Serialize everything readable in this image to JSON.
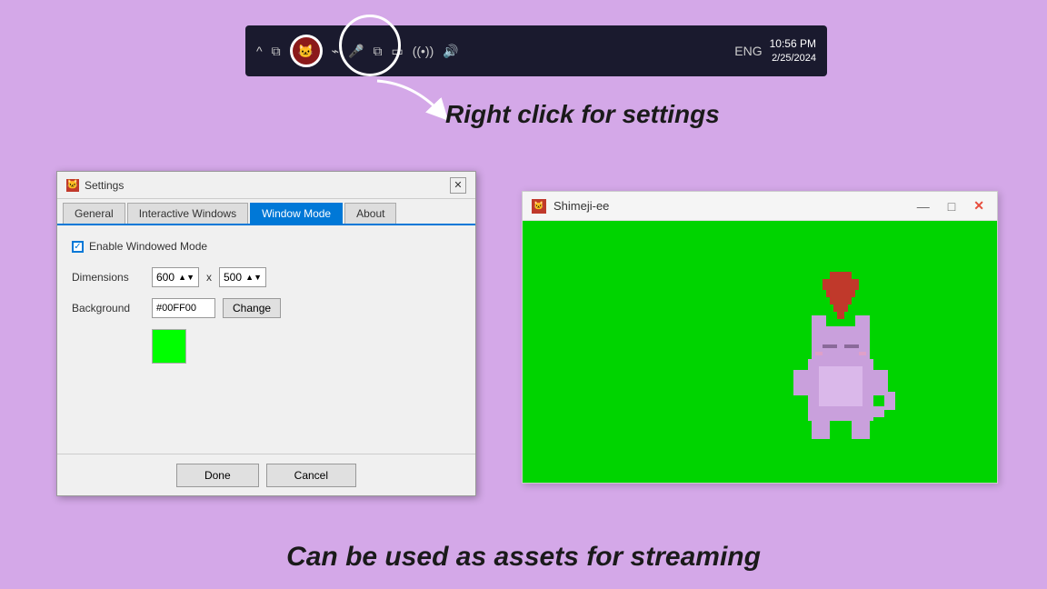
{
  "background_color": "#d4a8e8",
  "taskbar": {
    "time": "10:56 PM",
    "date": "2/25/2024",
    "language": "ENG",
    "app_icon": "🐱"
  },
  "annotation": {
    "right_click_text": "Right click for settings"
  },
  "settings_dialog": {
    "title": "Settings",
    "close_btn": "✕",
    "tabs": [
      {
        "label": "General",
        "active": false
      },
      {
        "label": "Interactive Windows",
        "active": false
      },
      {
        "label": "Window Mode",
        "active": true
      },
      {
        "label": "About",
        "active": false
      }
    ],
    "windowed_mode_label": "Enable Windowed Mode",
    "dimensions_label": "Dimensions",
    "width_value": "600",
    "height_value": "500",
    "x_separator": "x",
    "background_label": "Background",
    "background_color_value": "#00FF00",
    "change_btn": "Change",
    "done_btn": "Done",
    "cancel_btn": "Cancel"
  },
  "shimeji_window": {
    "title": "Shimeji-ee",
    "minimize_btn": "—",
    "maximize_btn": "□",
    "close_btn": "✕",
    "background_color": "#00d400"
  },
  "bottom_text": "Can be used as assets for streaming"
}
